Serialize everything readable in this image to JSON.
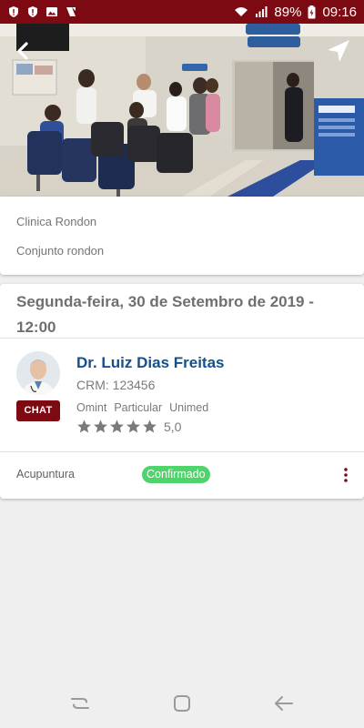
{
  "status_bar": {
    "battery_percent": "89%",
    "time": "09:16",
    "left_icons": [
      "alert-shield-icon",
      "alert-shield-icon",
      "image-icon",
      "app-notification-icon"
    ],
    "right_icons": [
      "wifi-icon",
      "signal-icon",
      "battery-icon"
    ]
  },
  "header": {
    "back_icon": "chevron-left-icon",
    "navigate_icon": "navigation-arrow-icon"
  },
  "clinic": {
    "name": "Clinica Rondon",
    "address": "Conjunto rondon"
  },
  "appointment": {
    "date": "Segunda-feira, 30 de Setembro de 2019 - 12:00",
    "doctor": {
      "name": "Dr. Luiz Dias Freitas",
      "crm": "CRM: 123456",
      "insurances": [
        "Omint",
        "Particular",
        "Unimed"
      ],
      "rating_value": "5,0",
      "rating_stars": 5,
      "chat_label": "CHAT"
    },
    "specialty": "Acupuntura",
    "status": "Confirmado",
    "status_color": "#4fd36b"
  },
  "colors": {
    "brand": "#7d0a12",
    "doctor_name": "#14508c"
  }
}
